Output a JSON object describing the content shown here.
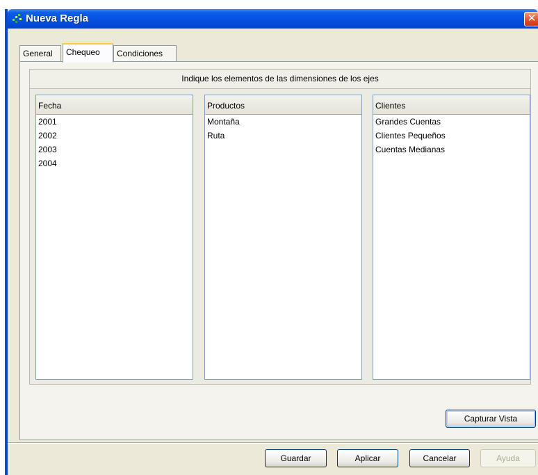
{
  "window": {
    "title": "Nueva Regla",
    "close_label": "✕"
  },
  "tabs": [
    {
      "label": "General",
      "active": false
    },
    {
      "label": "Chequeo",
      "active": true
    },
    {
      "label": "Condiciones",
      "active": false
    }
  ],
  "panel": {
    "header": "Indique los elementos de las dimensiones de los ejes"
  },
  "lists": [
    {
      "header": "Fecha",
      "items": [
        "2001",
        "2002",
        "2003",
        "2004"
      ]
    },
    {
      "header": "Productos",
      "items": [
        "Montaña",
        "Ruta"
      ]
    },
    {
      "header": "Clientes",
      "items": [
        "Grandes Cuentas",
        "Clientes Pequeños",
        "Cuentas Medianas"
      ]
    }
  ],
  "buttons": {
    "capture": "Capturar Vista",
    "save": "Guardar",
    "apply": "Aplicar",
    "cancel": "Cancelar",
    "help": "Ayuda"
  },
  "colors": {
    "titlebar": "#0553e3",
    "active_tab_accent": "#ffc73c",
    "dialog_bg": "#ece9d8"
  }
}
